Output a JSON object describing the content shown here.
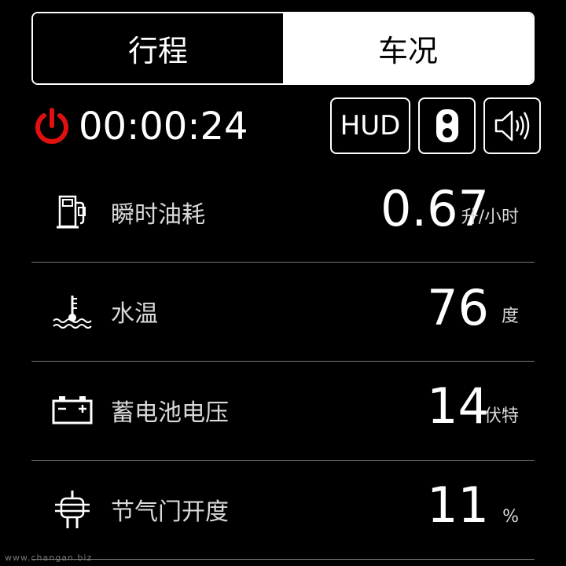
{
  "tabs": [
    {
      "label": "行程",
      "active": true
    },
    {
      "label": "车况",
      "active": false
    }
  ],
  "timer": {
    "value": "00:00:24"
  },
  "controls": {
    "hud_label": "HUD"
  },
  "icons": {
    "power": "power-icon",
    "traffic_light": "traffic-light-icon",
    "sound": "speaker-icon"
  },
  "colors": {
    "power": "#e01010",
    "accent": "#ffffff",
    "background": "#000000"
  },
  "metrics": [
    {
      "icon": "fuel-pump-icon",
      "label": "瞬时油耗",
      "value": "0.67",
      "unit": "升/小时"
    },
    {
      "icon": "water-temperature-icon",
      "label": "水温",
      "value": "76",
      "unit": "度"
    },
    {
      "icon": "battery-icon",
      "label": "蓄电池电压",
      "value": "14",
      "unit": "伏特"
    },
    {
      "icon": "throttle-icon",
      "label": "节气门开度",
      "value": "11",
      "unit": "%"
    }
  ],
  "watermark": "www.changan.biz"
}
